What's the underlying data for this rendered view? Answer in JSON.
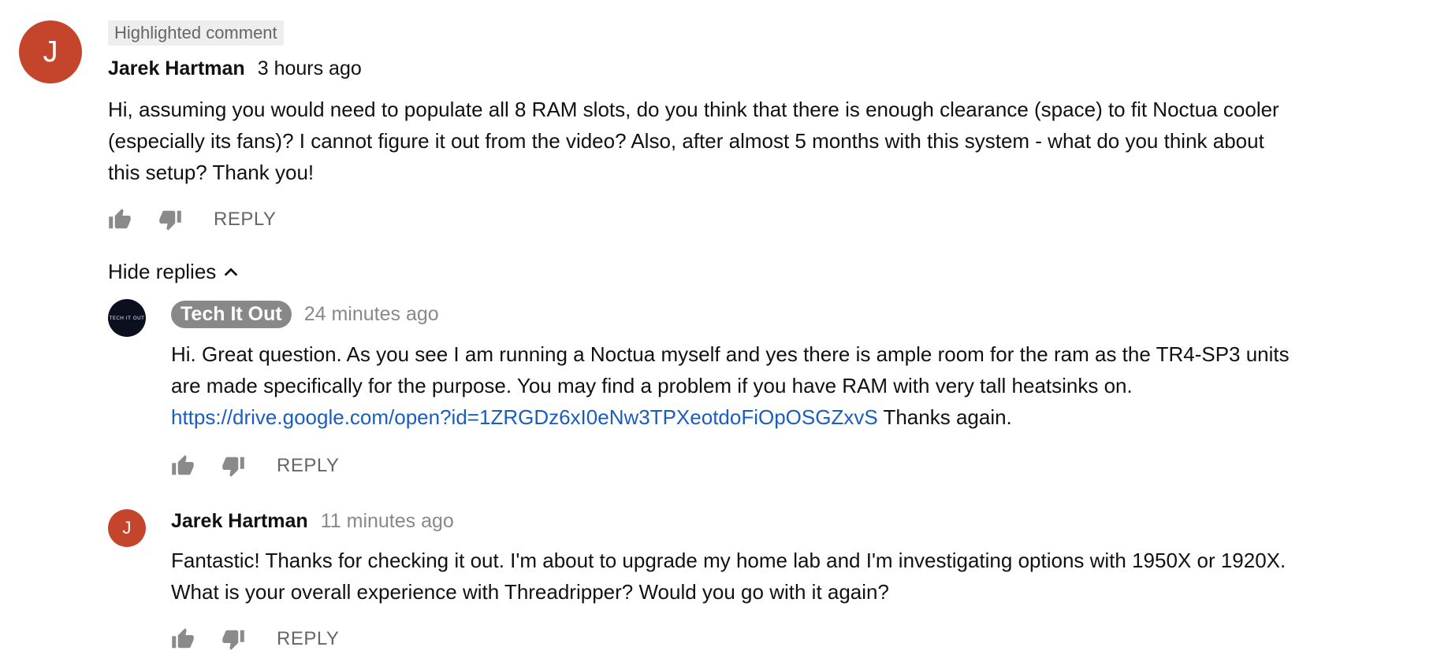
{
  "main_comment": {
    "avatar_letter": "J",
    "highlight_label": "Highlighted comment",
    "author": "Jarek Hartman",
    "time": "3 hours ago",
    "text_lines": [
      "Hi, assuming you would need to populate all 8 RAM slots, do you think that there is enough clearance (space) to fit Noctua cooler",
      "(especially its fans)? I cannot figure it out from the video?  Also, after almost 5 months with this system - what do you think about",
      "this setup? Thank you!"
    ],
    "reply_label": "REPLY",
    "like_icon": "thumb-up-icon",
    "dislike_icon": "thumb-down-icon"
  },
  "replies_toggle": {
    "label": "Hide replies",
    "icon": "chevron-up-icon"
  },
  "reply1": {
    "avatar_text": "TECH IT OUT",
    "author": "Tech It Out",
    "time": "24 minutes ago",
    "text_lines": [
      "Hi. Great question.  As you see I am running a Noctua myself and yes there is ample room for the ram as the TR4-SP3 units",
      "are made specifically for the purpose. You may find a problem if you have RAM with very tall heatsinks on."
    ],
    "link": "https://drive.google.com/open?id=1ZRGDz6xI0eNw3TPXeotdoFiOpOSGZxvS",
    "after_link": " Thanks again.",
    "reply_label": "REPLY"
  },
  "reply2": {
    "avatar_letter": "J",
    "author": "Jarek Hartman",
    "time": "11 minutes ago",
    "text_lines": [
      "Fantastic! Thanks for checking it out. I'm about to upgrade my home lab and I'm investigating options with 1950X or 1920X.",
      "What is your overall experience with Threadripper? Would you go with it again?"
    ],
    "reply_label": "REPLY"
  },
  "colors": {
    "avatar_red": "#c4452b",
    "link_blue": "#1a5dbf",
    "owner_badge_grey": "#888888",
    "icon_grey": "#8a8a8a"
  }
}
